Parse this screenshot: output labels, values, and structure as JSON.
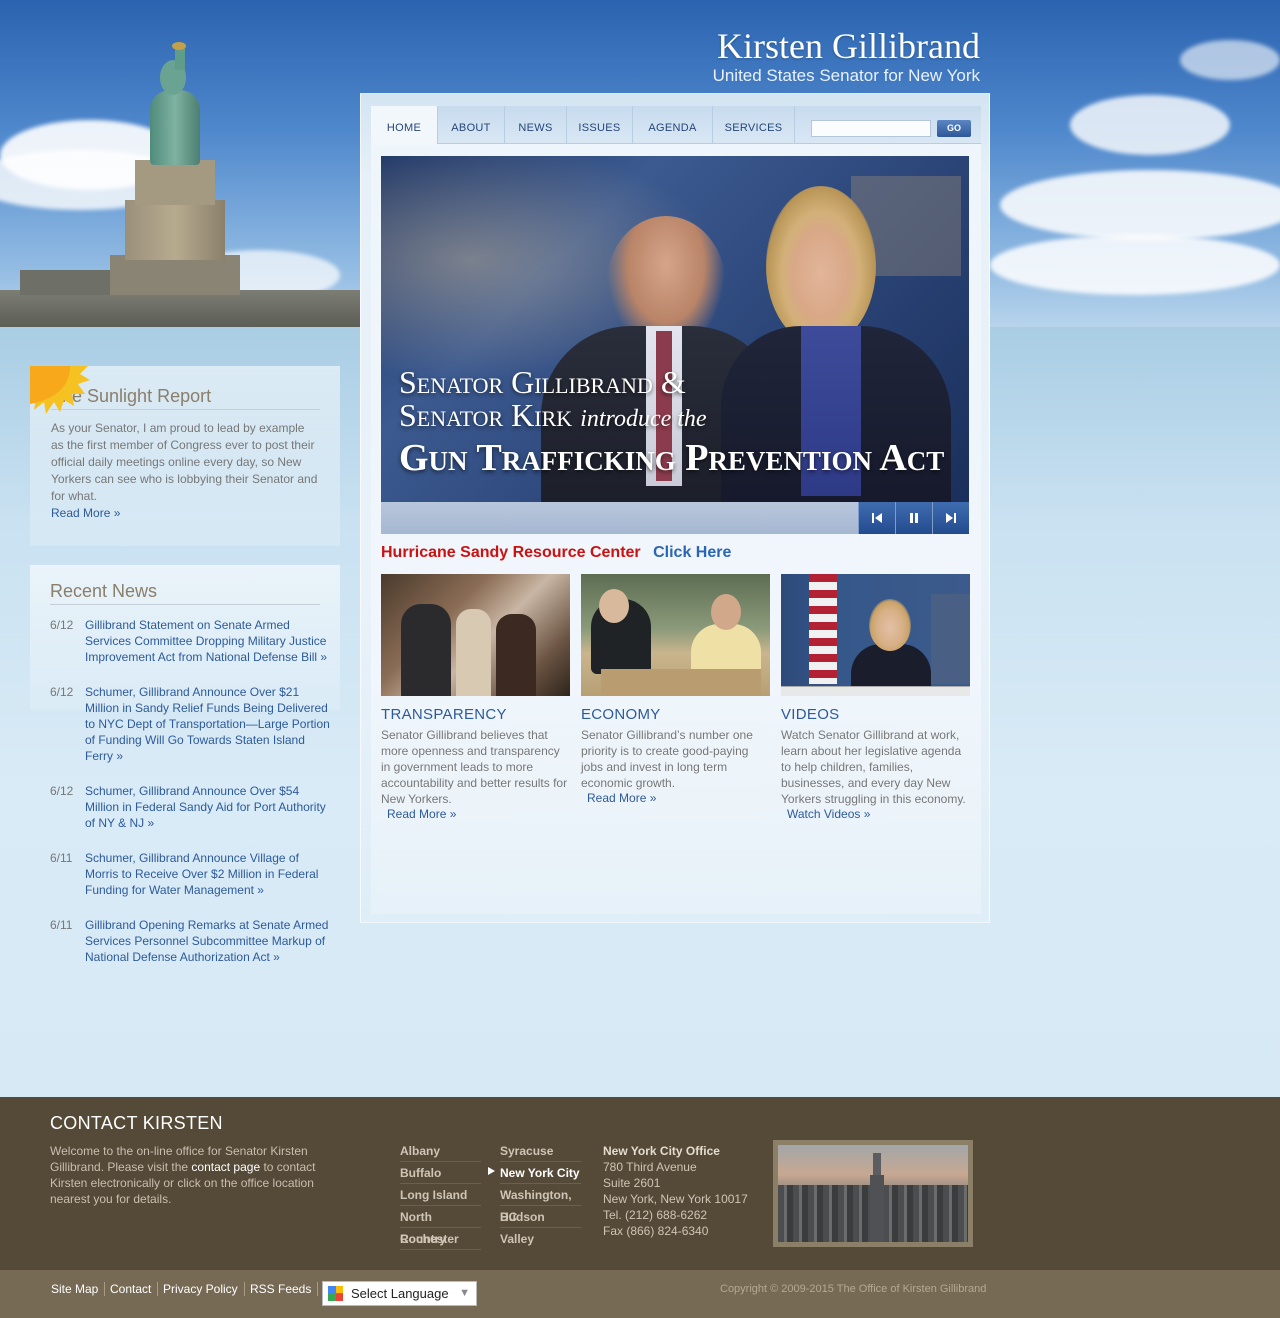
{
  "header": {
    "name": "Kirsten Gillibrand",
    "subtitle": "United States Senator for New York"
  },
  "nav": {
    "items": [
      "HOME",
      "ABOUT",
      "NEWS",
      "ISSUES",
      "AGENDA",
      "SERVICES"
    ],
    "active": "HOME",
    "search_placeholder": "",
    "go_label": "GO"
  },
  "slide": {
    "line1": "Senator Gillibrand &",
    "line2_main": "Senator Kirk",
    "line2_italic": "introduce the",
    "line3": "Gun Trafficking Prevention Act",
    "controls": {
      "prev": "prev-icon",
      "pause": "pause-icon",
      "next": "next-icon"
    }
  },
  "hurricane": {
    "label": "Hurricane Sandy Resource Center",
    "link": "Click Here"
  },
  "features": [
    {
      "title": "TRANSPARENCY",
      "desc": "Senator Gillibrand believes that more openness and transparency in government leads to more accountability and better results for New Yorkers.",
      "link": "Read More »"
    },
    {
      "title": "ECONOMY",
      "desc": "Senator Gillibrand’s number one priority is to create good-paying jobs and invest in long term economic growth.",
      "link": "Read More »"
    },
    {
      "title": "VIDEOS",
      "desc": "Watch Senator Gillibrand at work, learn about her legislative agenda to help children, families, businesses, and every day New Yorkers struggling in this economy.",
      "link": "Watch Videos »"
    }
  ],
  "sunlight": {
    "title": "The Sunlight Report",
    "text": "As your Senator, I am proud to lead by example as the first member of Congress ever to post their official daily meetings online every day, so New Yorkers can see who is lobbying their Senator and for what.",
    "link": "Read More »"
  },
  "recent_news": {
    "title": "Recent News",
    "items": [
      {
        "date": "6/12",
        "text": "Gillibrand Statement on Senate Armed Services Committee Dropping Military Justice Improvement Act from National Defense Bill  »"
      },
      {
        "date": "6/12",
        "text": "Schumer, Gillibrand Announce Over $21 Million in Sandy Relief Funds Being Delivered to NYC Dept of Transportation—Large Portion of Funding Will Go Towards Staten Island Ferry »"
      },
      {
        "date": "6/12",
        "text": "Schumer, Gillibrand Announce Over $54 Million in Federal Sandy Aid for Port Authority of NY & NJ »"
      },
      {
        "date": "6/11",
        "text": "Schumer, Gillibrand Announce Village of Morris to Receive Over $2 Million in Federal Funding for Water Management »"
      },
      {
        "date": "6/11",
        "text": "Gillibrand Opening Remarks at Senate Armed Services Personnel Subcommittee Markup of National Defense Authorization Act »"
      }
    ]
  },
  "contact": {
    "title": "CONTACT KIRSTEN",
    "text_before": "Welcome to the on-line office for Senator Kirsten Gillibrand. Please visit the ",
    "link": "contact page",
    "text_after": " to contact Kirsten electronically or click on the office location nearest you for details.",
    "offices_col1": [
      "Albany",
      "Buffalo",
      "Long Island",
      "North Country",
      "Rochester"
    ],
    "offices_col2": [
      "Syracuse",
      "New York City",
      "Washington, DC",
      "Hudson Valley"
    ],
    "selected_office": "New York City",
    "office_info": {
      "name": "New York City Office",
      "address1": "780 Third Avenue",
      "address2": "Suite 2601",
      "city": "New York, New York 10017",
      "tel": "Tel. (212) 688-6262",
      "fax": "Fax (866) 824-6340"
    }
  },
  "footer": {
    "links": [
      "Site Map",
      "Contact",
      "Privacy Policy",
      "RSS Feeds"
    ],
    "translate_label": "Select Language",
    "copyright": "Copyright © 2009-2015 The Office of Kirsten Gillibrand"
  },
  "colors": {
    "accent_blue": "#2d5a9c",
    "hurricane_red": "#cc1111",
    "footer_brown": "#554938"
  }
}
